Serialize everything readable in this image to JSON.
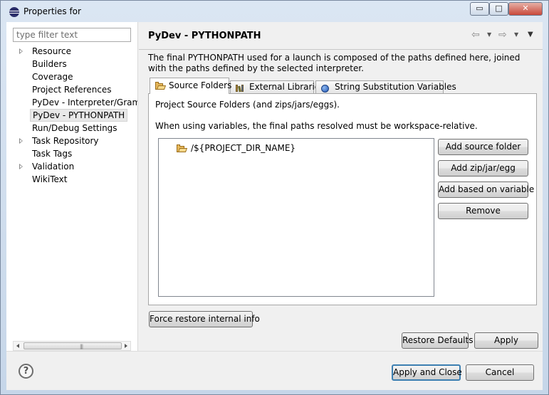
{
  "window": {
    "title": "Properties for",
    "minimize_glyph": "▭",
    "maximize_glyph": "□",
    "close_glyph": "✕"
  },
  "filter": {
    "placeholder": "type filter text"
  },
  "tree": {
    "items": [
      {
        "label": "Resource",
        "expandable": true
      },
      {
        "label": "Builders",
        "expandable": false
      },
      {
        "label": "Coverage",
        "expandable": false
      },
      {
        "label": "Project References",
        "expandable": false
      },
      {
        "label": "PyDev - Interpreter/Grammar",
        "expandable": false
      },
      {
        "label": "PyDev - PYTHONPATH",
        "expandable": false,
        "selected": true
      },
      {
        "label": "Run/Debug Settings",
        "expandable": false
      },
      {
        "label": "Task Repository",
        "expandable": true
      },
      {
        "label": "Task Tags",
        "expandable": false
      },
      {
        "label": "Validation",
        "expandable": true
      },
      {
        "label": "WikiText",
        "expandable": false
      }
    ],
    "scroll_grip": "|||"
  },
  "page": {
    "title": "PyDev - PYTHONPATH",
    "nav": {
      "back": "⇦",
      "back_dropdown": "▼",
      "forward": "⇨",
      "forward_dropdown": "▼",
      "menu": "▼"
    },
    "description": "The final PYTHONPATH used for a launch is composed of the paths defined here, joined with the paths defined by the selected interpreter."
  },
  "tabs": [
    {
      "label": "Source Folders",
      "icon": "folder-icon",
      "active": true
    },
    {
      "label": "External Libraries",
      "icon": "library-icon",
      "active": false
    },
    {
      "label": "String Substitution Variables",
      "icon": "variable-icon",
      "active": false
    }
  ],
  "source_folders": {
    "heading": "Project Source Folders (and zips/jars/eggs).",
    "note": "When using variables, the final paths resolved must be workspace-relative.",
    "items": [
      "/${PROJECT_DIR_NAME}"
    ],
    "buttons": {
      "add_source_folder": "Add source folder",
      "add_zip": "Add zip/jar/egg",
      "add_variable": "Add based on variable",
      "remove": "Remove"
    }
  },
  "actions": {
    "force_restore": "Force restore internal info",
    "restore_defaults": "Restore Defaults",
    "apply": "Apply",
    "apply_and_close": "Apply and Close",
    "cancel": "Cancel",
    "help_glyph": "?"
  },
  "colors": {
    "window_frame": "#c6d6e9",
    "dialog_bg": "#f0f0f0",
    "default_button_border": "#3c7fb1"
  }
}
